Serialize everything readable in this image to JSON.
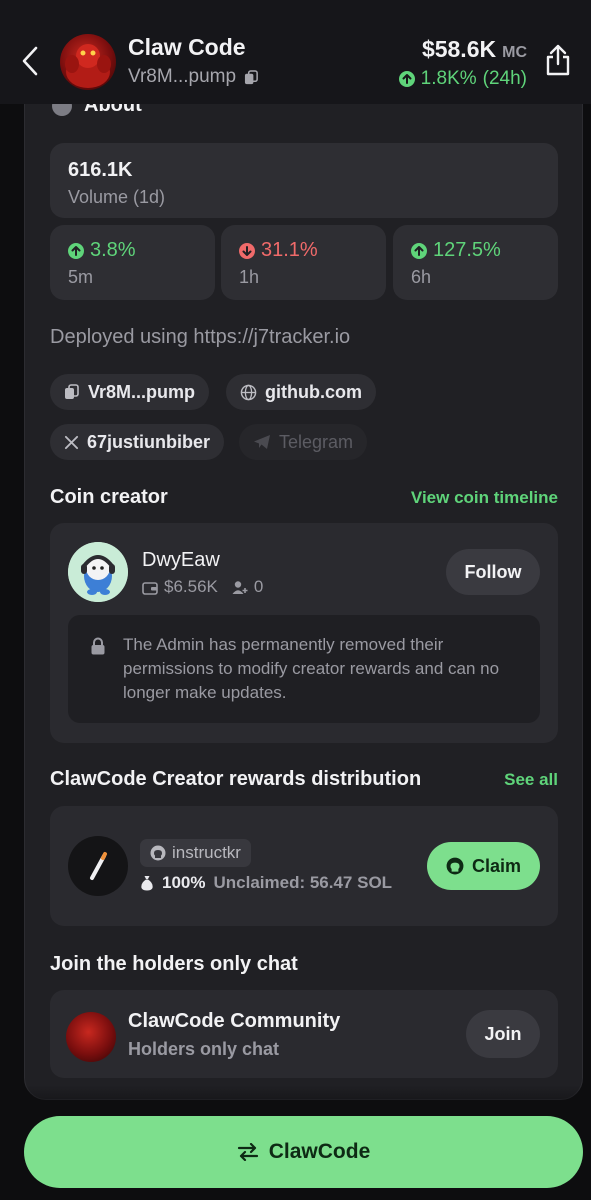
{
  "header": {
    "title": "Claw Code",
    "address": "Vr8M...pump",
    "market_cap": "$58.6K",
    "market_cap_unit": "MC",
    "change_value": "1.8K%",
    "change_period": "(24h)"
  },
  "about": {
    "title": "About",
    "volume_value": "616.1K",
    "volume_label": "Volume (1d)",
    "stats": [
      {
        "value": "3.8%",
        "label": "5m",
        "direction": "up"
      },
      {
        "value": "31.1%",
        "label": "1h",
        "direction": "down"
      },
      {
        "value": "127.5%",
        "label": "6h",
        "direction": "up"
      }
    ],
    "description": "Deployed using https://j7tracker.io",
    "links": {
      "address": "Vr8M...pump",
      "website": "github.com",
      "x_handle": "67justiunbiber",
      "telegram": "Telegram"
    }
  },
  "creator": {
    "section_title": "Coin creator",
    "timeline_link": "View coin timeline",
    "name": "DwyEaw",
    "holdings": "$6.56K",
    "followers": "0",
    "follow_label": "Follow",
    "notice": "The Admin has permanently removed their permissions to modify creator rewards and can no longer make updates."
  },
  "rewards": {
    "section_title": "ClawCode Creator rewards distribution",
    "see_all": "See all",
    "github_user": "instructkr",
    "share": "100%",
    "unclaimed": "Unclaimed: 56.47 SOL",
    "claim_label": "Claim"
  },
  "community": {
    "section_title": "Join the holders only chat",
    "name": "ClawCode Community",
    "subtitle": "Holders only chat",
    "join_label": "Join"
  },
  "cta": {
    "label": "ClawCode"
  },
  "colors": {
    "accent_green": "#5fd47a",
    "button_green": "#7ddf8d",
    "down_red": "#f06a6a",
    "background": "#0d0d0f",
    "card": "#202024"
  }
}
